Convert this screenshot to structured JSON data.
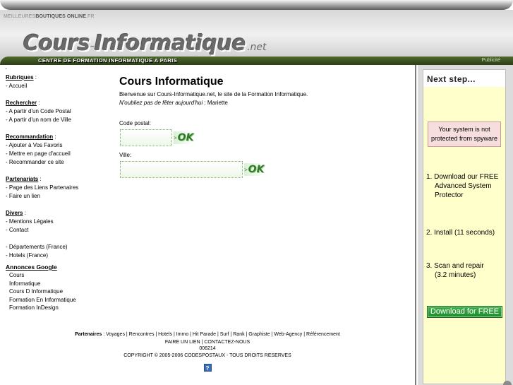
{
  "header": {
    "top_label_prefix": "MEILLEURES",
    "top_label_bold": "BOUTIQUES ONLINE",
    "top_label_suffix": ".FR",
    "logo_part1": "Cours",
    "logo_dash": "-",
    "logo_part2": "Informatique",
    "logo_net": ".net",
    "subtitle": "CENTRE DE FORMATION INFORMATIQUE A PARIS",
    "publicite": "Publicité"
  },
  "sidebar": {
    "dot": "'",
    "rubriques": {
      "title": "Rubriques",
      "sep": " :",
      "items": [
        "- Accueil"
      ]
    },
    "rechercher": {
      "title": "Rechercher",
      "sep": " :",
      "items": [
        "- A partir d'un Code Postal",
        "- A partir d'un nom de Ville"
      ]
    },
    "recommandation": {
      "title": "Recommandation",
      "sep": " :",
      "items": [
        "- Ajouter à Vos Favoris",
        "- Mettre en page d'accueil",
        "- Recommander ce site"
      ]
    },
    "partenariats": {
      "title": "Partenariats",
      "sep": " :",
      "items": [
        "- Page des Liens Partenaires",
        "- Faire un lien"
      ]
    },
    "divers": {
      "title": "Divers",
      "sep": " :",
      "items": [
        "- Mentions Légales",
        "- Contact"
      ]
    },
    "extra": [
      "- Départements (France)",
      "- Hotels (France)"
    ],
    "annonces": {
      "title": "Annonces Google",
      "links": [
        "Cours",
        "Informatique",
        "Cours D Informatique",
        "Formation En Informatique",
        "Formation InDesign"
      ]
    }
  },
  "main": {
    "title": "Cours Informatique",
    "intro": "Bienvenue sur Cours-Informatique.net, le site de la Formation Informatique.",
    "fete_italic": "N'oubliez pas de fêter aujourd'hui",
    "fete_rest": " : Mariette",
    "code_postal_label": "Code postal:",
    "ville_label": "Ville:",
    "ok_arrow": ">",
    "ok_label": "OK"
  },
  "footer": {
    "partners_label": "Partenaires",
    "partners_list": " : Voyages | Rencontres | Hotels | Immo | Hit Parade | Surf | Rank | Graphiste | Web-Agency | Référencement",
    "links": "FAIRE UN LIEN | CONTACTEZ-NOUS",
    "counter": "006214",
    "copyright": "COPYRIGHT © 2005-2006 CODESPOSTAUX - TOUS DROITS RESERVES",
    "help": "?"
  },
  "ad": {
    "heading": "Next step...",
    "warning": "Your system is not protected from spyware",
    "step1_line1": "1. Download our FREE",
    "step1_line2": "Advanced System",
    "step1_line3": "Protector",
    "step2": "2. Install (11 seconds)",
    "step3_line1": "3. Scan and repair",
    "step3_line2": "(3.2 minutes)",
    "download_button": "Download for FREE"
  },
  "colors": {
    "subbar": "#2c3d18",
    "ok_green": "#2f7a2a",
    "ad_background": "#ffffcc",
    "download_button": "#1f8a2d",
    "warning_background": "#f7dede"
  }
}
